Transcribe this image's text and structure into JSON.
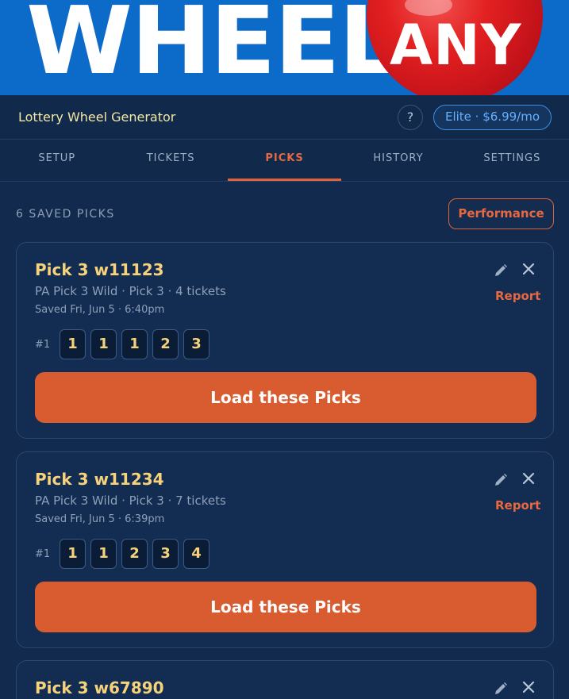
{
  "banner": {
    "word": "WHEEL",
    "ball_text": "ANY"
  },
  "header": {
    "title": "Lottery Wheel Generator",
    "help_label": "?",
    "plan_label": "Elite · $6.99/mo"
  },
  "tabs": [
    {
      "label": "SETUP",
      "active": false
    },
    {
      "label": "TICKETS",
      "active": false
    },
    {
      "label": "PICKS",
      "active": true
    },
    {
      "label": "HISTORY",
      "active": false
    },
    {
      "label": "SETTINGS",
      "active": false
    }
  ],
  "picks": {
    "count_label": "6 SAVED PICKS",
    "performance_label": "Performance",
    "items": [
      {
        "title": "Pick 3 w11123",
        "subtitle": "PA Pick 3 Wild · Pick 3 · 4 tickets",
        "saved": "Saved Fri, Jun 5 · 6:40pm",
        "report_label": "Report",
        "row_label": "#1",
        "numbers": [
          "1",
          "1",
          "1",
          "2",
          "3"
        ],
        "load_label": "Load these Picks"
      },
      {
        "title": "Pick 3 w11234",
        "subtitle": "PA Pick 3 Wild · Pick 3 · 7 tickets",
        "saved": "Saved Fri, Jun 5 · 6:39pm",
        "report_label": "Report",
        "row_label": "#1",
        "numbers": [
          "1",
          "1",
          "2",
          "3",
          "4"
        ],
        "load_label": "Load these Picks"
      },
      {
        "title": "Pick 3 w67890"
      }
    ]
  },
  "colors": {
    "accent": "#d95b30",
    "gold": "#f6d37a",
    "plan_blue": "#3a8fe8",
    "background": "#122a4e"
  },
  "icons": {
    "edit": "pencil-icon",
    "delete": "close-icon"
  }
}
